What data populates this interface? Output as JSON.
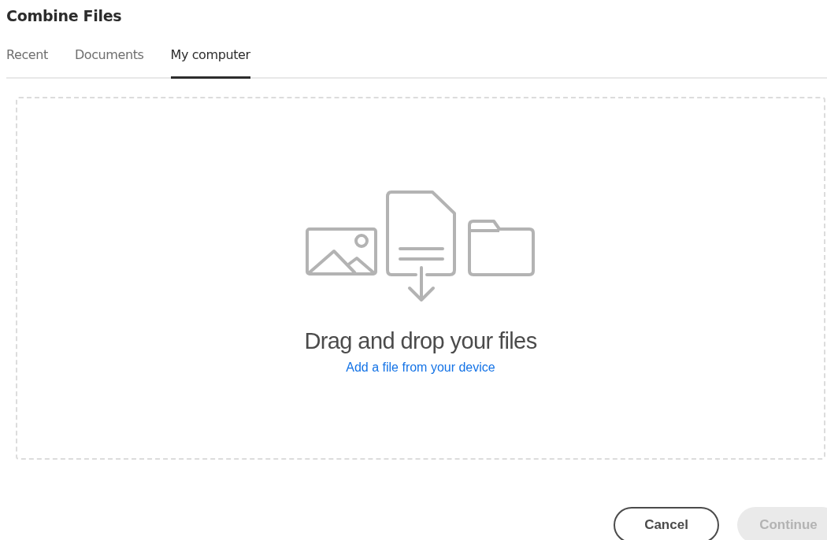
{
  "title": "Combine Files",
  "tabs": [
    {
      "label": "Recent",
      "selected": false
    },
    {
      "label": "Documents",
      "selected": false
    },
    {
      "label": "My computer",
      "selected": true
    }
  ],
  "dropzone": {
    "heading": "Drag and drop your files",
    "link": "Add a file from your device"
  },
  "buttons": [
    {
      "label": "Cancel",
      "kind": "secondary",
      "disabled": false
    },
    {
      "label": "Continue",
      "kind": "primary",
      "disabled": true
    }
  ]
}
